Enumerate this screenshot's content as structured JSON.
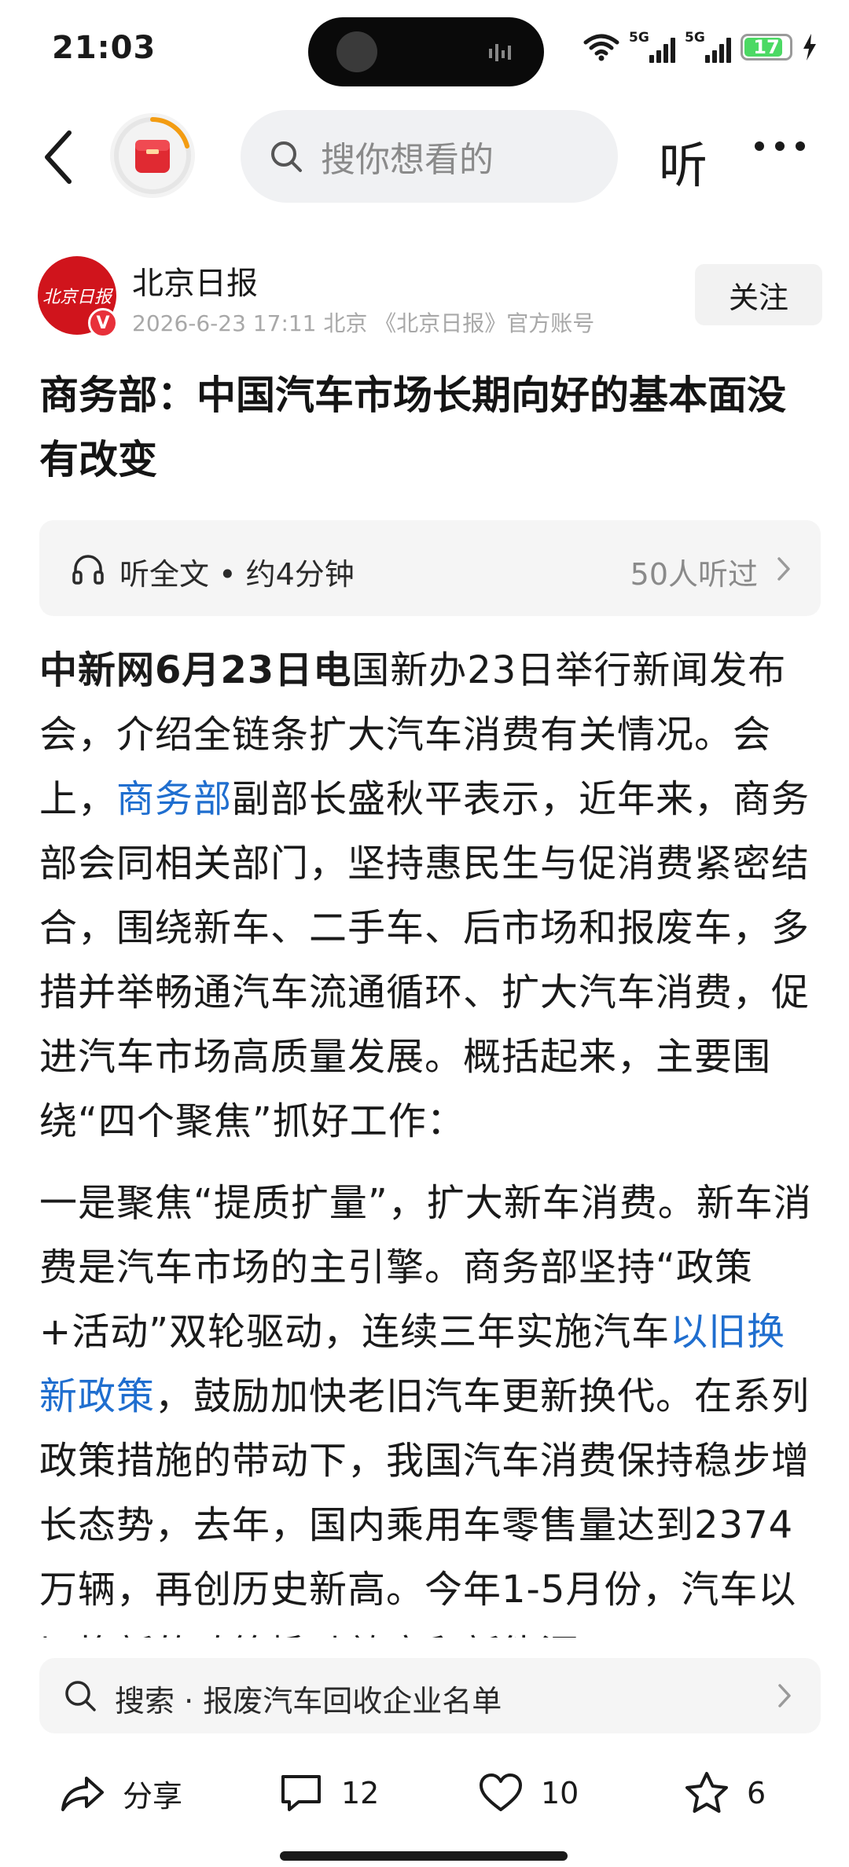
{
  "status_bar": {
    "time": "21:03",
    "signal1_label": "5G",
    "signal2_label": "5G",
    "battery_level": "17",
    "battery_fraction": 0.17
  },
  "nav": {
    "search_placeholder": "搜你想看的",
    "listen_label": "听"
  },
  "author": {
    "name": "北京日报",
    "meta": "2026-6-23  17:11  北京  《北京日报》官方账号",
    "avatar_text": "北京日报",
    "verified_badge": "V",
    "follow_label": "关注"
  },
  "article": {
    "title": "商务部：中国汽车市场长期向好的基本面没有改变",
    "listen_full": "听全文 • 约4分钟",
    "listen_count": "50人听过",
    "p1_lead": "中新网6月23日电",
    "p1_text_a": "国新办23日举行新闻发布会，介绍全链条扩大汽车消费有关情况。会上，",
    "p1_link": "商务部",
    "p1_text_b": "副部长盛秋平表示，近年来，商务部会同相关部门，坚持惠民生与促消费紧密结合，围绕新车、二手车、后市场和报废车，多措并举畅通汽车流通循环、扩大汽车消费，促进汽车市场高质量发展。概括起来，主要围绕“四个聚焦”抓好工作：",
    "p2_text_a": "一是聚焦“提质扩量”，扩大新车消费。新车消费是汽车市场的主引擎。商务部坚持“政策+活动”双轮驱动，连续三年实施汽车",
    "p2_link": "以旧换新政策",
    "p2_text_b": "，鼓励加快老旧汽车更新换代。在系列政策措施的带动下，我国汽车消费保持稳步增长态势，去年，国内乘用车零售量达到2374万辆，再创历史新高。今年1-5月份，汽车以旧换新的政策撬动效应和新能源"
  },
  "suggest": {
    "text": "搜索 · 报废汽车回收企业名单"
  },
  "actions": {
    "share_label": "分享",
    "comment_count": "12",
    "like_count": "10",
    "favorite_count": "6"
  }
}
